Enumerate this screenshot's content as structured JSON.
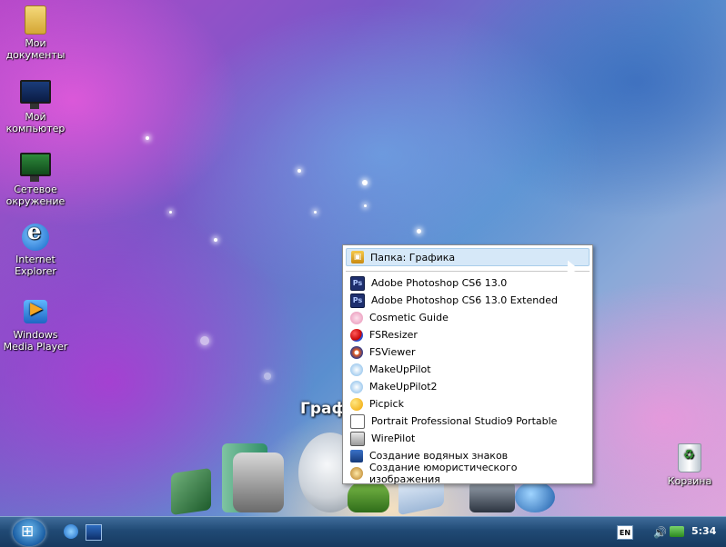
{
  "desktop": {
    "icons": [
      {
        "label": "Мои документы",
        "icon": "my-documents-folder-icon"
      },
      {
        "label": "Мой компьютер",
        "icon": "computer-icon"
      },
      {
        "label": "Сетевое окружение",
        "icon": "network-icon"
      },
      {
        "label": "Internet Explorer",
        "icon": "internet-explorer-icon"
      },
      {
        "label": "Windows Media Player",
        "icon": "media-player-icon"
      },
      {
        "label": "Корзина",
        "icon": "recycle-bin-icon"
      }
    ]
  },
  "dock": {
    "title": "Граф"
  },
  "menu": {
    "header": {
      "label": "Папка: Графика",
      "icon": "folder-graphics-icon"
    },
    "items": [
      {
        "label": "Adobe Photoshop CS6 13.0",
        "icon": "photoshop-icon"
      },
      {
        "label": "Adobe Photoshop CS6 13.0 Extended",
        "icon": "photoshop-icon"
      },
      {
        "label": "Cosmetic Guide",
        "icon": "cosmetic-guide-icon"
      },
      {
        "label": "FSResizer",
        "icon": "fsresizer-icon"
      },
      {
        "label": "FSViewer",
        "icon": "fsviewer-icon"
      },
      {
        "label": "MakeUpPilot",
        "icon": "makeuppilot-icon"
      },
      {
        "label": "MakeUpPilot2",
        "icon": "makeuppilot-icon"
      },
      {
        "label": "Picpick",
        "icon": "picpick-icon"
      },
      {
        "label": "Portrait Professional Studio9 Portable",
        "icon": "portrait-pro-icon"
      },
      {
        "label": "WirePilot",
        "icon": "wirepilot-icon"
      },
      {
        "label": "Создание водяных знаков",
        "icon": "watermark-icon"
      },
      {
        "label": "Создание юмористического изображения",
        "icon": "humor-image-icon"
      }
    ]
  },
  "taskbar": {
    "language": "EN",
    "clock": "5:34"
  }
}
